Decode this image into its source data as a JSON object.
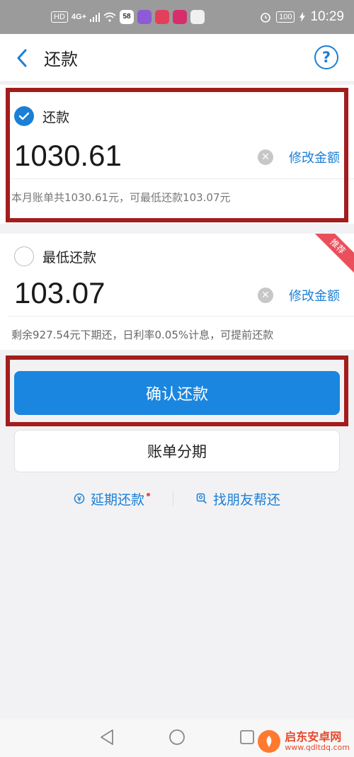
{
  "status_bar": {
    "hd": "HD",
    "signal": "4G+",
    "app_58": "58",
    "battery": "100",
    "time": "10:29"
  },
  "nav": {
    "title": "还款",
    "help": "?"
  },
  "full_repayment": {
    "label": "还款",
    "amount": "1030.61",
    "modify": "修改金额",
    "note": "本月账单共1030.61元，可最低还款103.07元",
    "selected": true
  },
  "min_repayment": {
    "label": "最低还款",
    "amount": "103.07",
    "modify": "修改金额",
    "badge": "推荐",
    "note": "剩余927.54元下期还，日利率0.05%计息，可提前还款",
    "selected": false
  },
  "buttons": {
    "confirm": "确认还款",
    "installment": "账单分期"
  },
  "links": {
    "defer": "延期还款",
    "friend": "找朋友帮还"
  },
  "watermark": {
    "title": "启东安卓网",
    "url": "www.qdltdq.com"
  },
  "colors": {
    "accent": "#1a7fd6",
    "highlight_box": "#a31d1d",
    "badge": "#e9505c"
  }
}
